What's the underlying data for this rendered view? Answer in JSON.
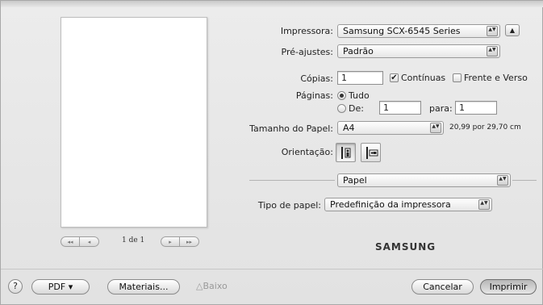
{
  "printer": {
    "label": "Impressora:",
    "value": "Samsung SCX-6545 Series"
  },
  "presets": {
    "label": "Pré-ajustes:",
    "value": "Padrão"
  },
  "copies": {
    "label": "Cópias:",
    "value": "1",
    "collated_label": "Contínuas",
    "duplex_label": "Frente e Verso"
  },
  "pages": {
    "label": "Páginas:",
    "all_label": "Tudo",
    "from_label": "De:",
    "from_value": "1",
    "to_label": "para:",
    "to_value": "1"
  },
  "paper_size": {
    "label": "Tamanho do Papel:",
    "value": "A4",
    "dimensions": "20,99 por 29,70 cm"
  },
  "orientation": {
    "label": "Orientação:"
  },
  "panel": {
    "value": "Papel"
  },
  "paper_type": {
    "label": "Tipo de papel:",
    "value": "Predefinição da impressora"
  },
  "preview": {
    "page_info": "1 de 1",
    "nav_first": "◂◂",
    "nav_prev": "◂",
    "nav_next": "▸",
    "nav_last": "▸▸"
  },
  "brand": "SAMSUNG",
  "footer": {
    "help": "?",
    "pdf": "PDF ▾",
    "supplies": "Materiais...",
    "supplies_level": "Baixo",
    "cancel": "Cancelar",
    "print": "Imprimir"
  },
  "icons": {
    "disclosure": "▲",
    "popup_arrows": "▲▼",
    "checkmark": "✔"
  }
}
